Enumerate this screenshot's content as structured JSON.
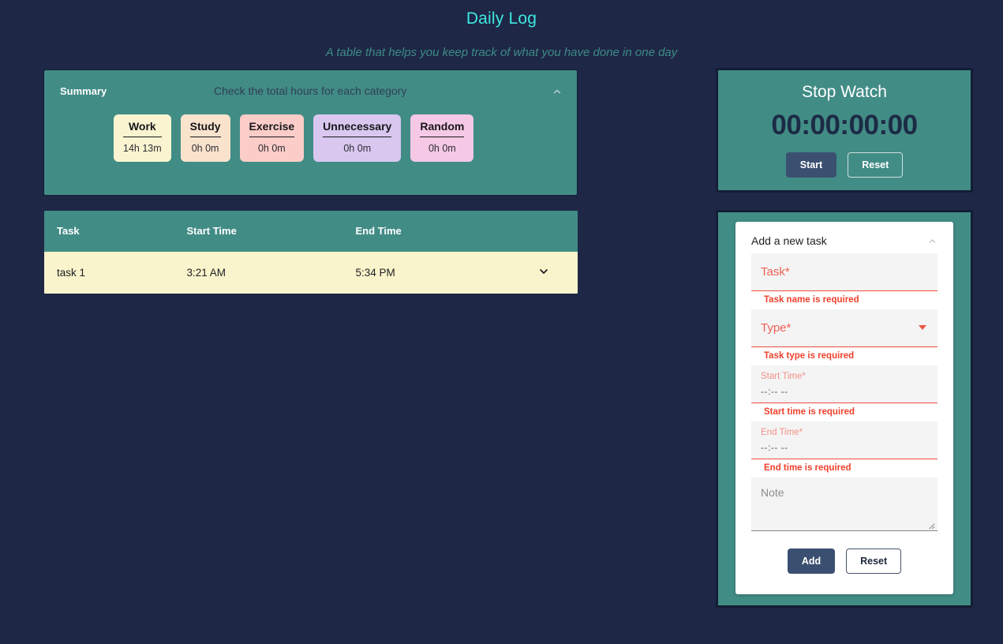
{
  "header": {
    "title": "Daily Log",
    "subtitle": "A table that helps you keep track of what you have done in one day"
  },
  "summary": {
    "label": "Summary",
    "caption": "Check the total hours for each category",
    "collapse_icon": "chevron-up-icon",
    "chips": [
      {
        "name": "Work",
        "value": "14h 13m",
        "color": "#faf5d0"
      },
      {
        "name": "Study",
        "value": "0h 0m",
        "color": "#fae3cd"
      },
      {
        "name": "Exercise",
        "value": "0h 0m",
        "color": "#fccdc8"
      },
      {
        "name": "Unnecessary",
        "value": "0h 0m",
        "color": "#d9c7f0"
      },
      {
        "name": "Random",
        "value": "0h 0m",
        "color": "#f5c8e5"
      }
    ]
  },
  "table": {
    "columns": [
      "Task",
      "Start Time",
      "End Time",
      ""
    ],
    "rows": [
      {
        "task": "task 1",
        "start": "3:21 AM",
        "end": "5:34 PM",
        "expand_icon": "chevron-down-icon"
      }
    ]
  },
  "stopwatch": {
    "title": "Stop Watch",
    "time": "00:00:00:00",
    "start_label": "Start",
    "reset_label": "Reset"
  },
  "add_task": {
    "panel_title": "Add a new task",
    "collapse_icon": "chevron-up-icon",
    "task_placeholder": "Task*",
    "task_error": "Task name is required",
    "type_placeholder": "Type*",
    "type_error": "Task type is required",
    "start_time_label": "Start Time*",
    "start_time_value": "--:-- --",
    "start_time_error": "Start time is required",
    "end_time_label": "End Time*",
    "end_time_value": "--:-- --",
    "end_time_error": "End time is required",
    "note_placeholder": "Note",
    "add_label": "Add",
    "reset_label": "Reset"
  },
  "colors": {
    "background": "#1e2746",
    "teal": "#428c86",
    "accent_cyan": "#3fe9e0",
    "error_red": "#f0402c",
    "navy_button": "#3b5070",
    "row_yellow": "#f9f4cb"
  }
}
